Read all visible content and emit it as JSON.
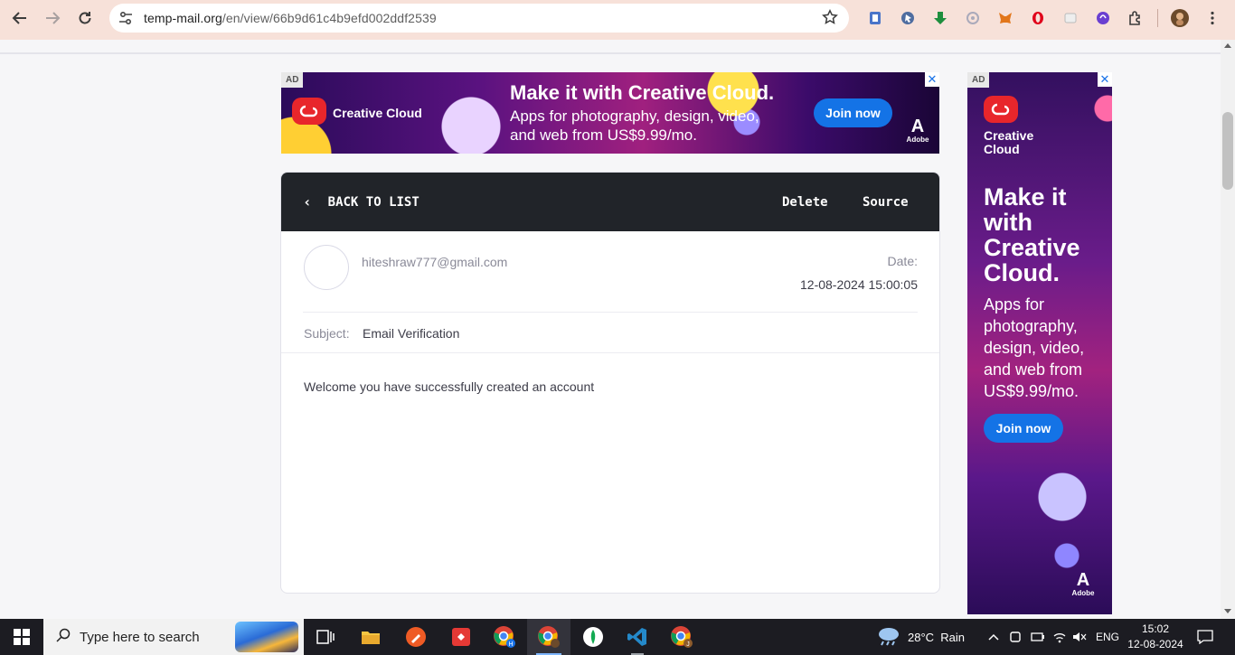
{
  "browser": {
    "url_host": "temp-mail.org",
    "url_path": "/en/view/66b9d61c4b9efd002ddf2539"
  },
  "ad_top": {
    "badge": "AD",
    "brand": "Creative Cloud",
    "headline": "Make it with Creative Cloud.",
    "sub": "Apps for photography, design, video, and web from US$9.99/mo.",
    "cta": "Join now",
    "adobe": "Adobe"
  },
  "ad_side": {
    "badge": "AD",
    "brand_line1": "Creative",
    "brand_line2": "Cloud",
    "headline": "Make it with Creative Cloud.",
    "sub": "Apps for photography, design, video, and web from US$9.99/mo.",
    "cta": "Join now",
    "adobe": "Adobe"
  },
  "email": {
    "back_label": "BACK TO LIST",
    "delete_label": "Delete",
    "source_label": "Source",
    "from": "hiteshraw777@gmail.com",
    "date_label": "Date:",
    "date_value": "12-08-2024 15:00:05",
    "subject_label": "Subject:",
    "subject_value": "Email Verification",
    "body": "Welcome you have successfully created an account"
  },
  "taskbar": {
    "search_placeholder": "Type here to search",
    "weather": "28°C  Rain",
    "language": "ENG",
    "time": "15:02",
    "date": "12-08-2024"
  },
  "colors": {
    "toolbar_bg": "#f7e1d9",
    "card_header_bg": "#212429",
    "accent_blue": "#1473e6",
    "adobe_red": "#e8262b"
  }
}
